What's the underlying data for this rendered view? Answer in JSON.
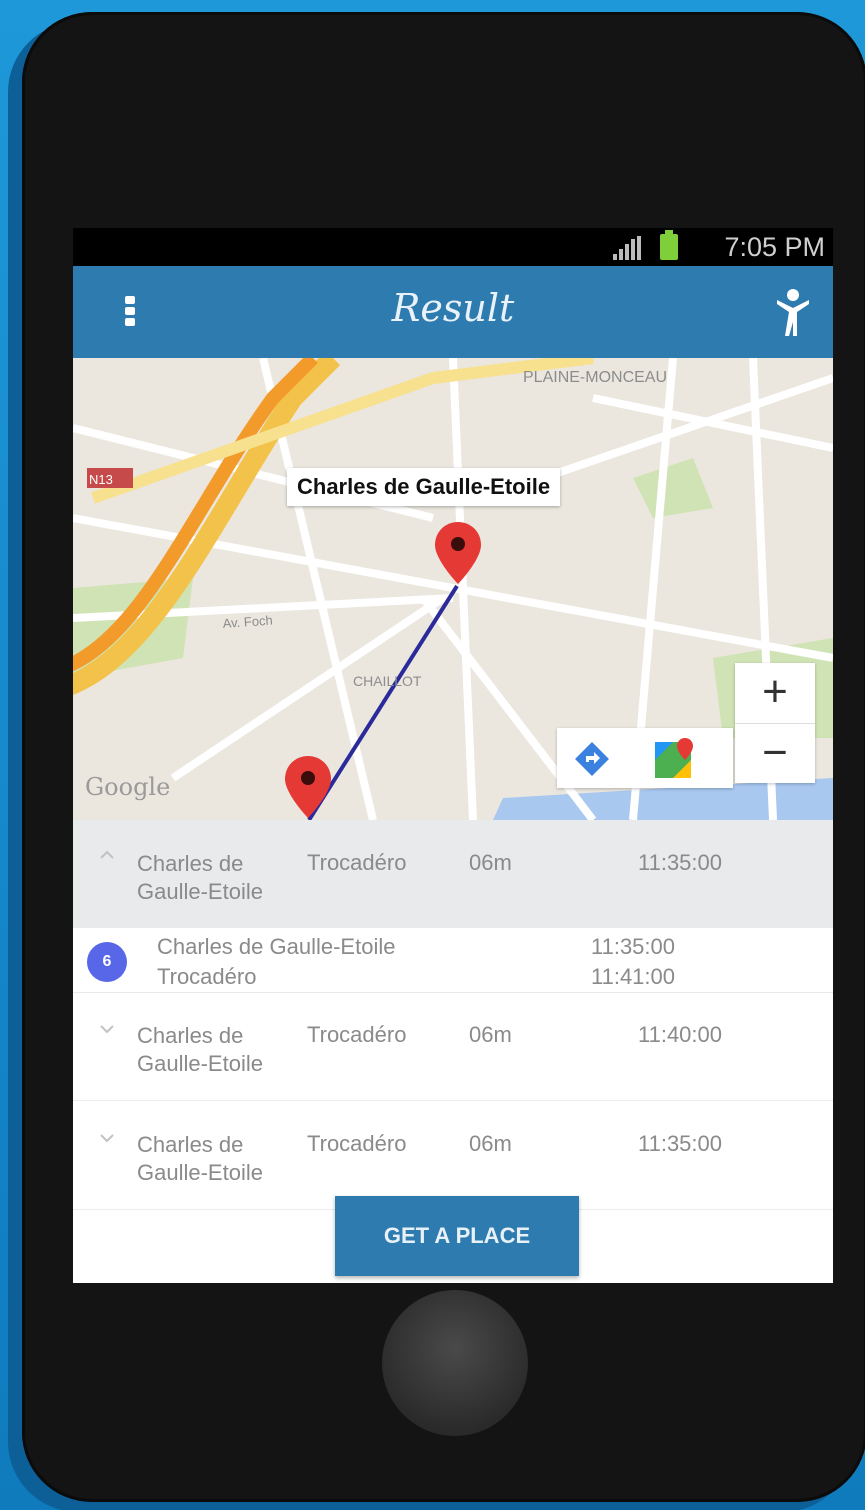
{
  "status_bar": {
    "time": "7:05 PM"
  },
  "app_bar": {
    "title": "Result"
  },
  "map": {
    "station_label": "Charles de Gaulle-Etoile",
    "zoom_in": "+",
    "zoom_out": "−",
    "attribution": "Google",
    "street_labels": [
      "PLAINE-MONCEAU",
      "N13",
      "Av. Foch",
      "CHAILLOT"
    ]
  },
  "list": {
    "rows": [
      {
        "origin": "Charles de Gaulle-Etoile",
        "destination": "Trocadéro",
        "duration": "06m",
        "time": "11:35:00",
        "state": "collapsed"
      },
      {
        "badge": "6",
        "line1": "Charles de Gaulle-Etoile",
        "line2": "Trocadéro",
        "time1": "11:35:00",
        "time2": "11:41:00",
        "state": "expanded"
      },
      {
        "origin": "Charles de Gaulle-Etoile",
        "destination": "Trocadéro",
        "duration": "06m",
        "time": "11:40:00",
        "state": "collapsed"
      },
      {
        "origin": "Charles de Gaulle-Etoile",
        "destination": "Trocadéro",
        "duration": "06m",
        "time": "11:35:00",
        "state": "collapsed"
      }
    ]
  },
  "cta": {
    "label": "GET A PLACE"
  },
  "colors": {
    "primary": "#2e7bb0",
    "background": "#1487c9",
    "badge": "#5866e8",
    "marker": "#e53935",
    "route": "#2a2a9a"
  },
  "icons": [
    "signal-icon",
    "battery-icon",
    "menu-icon",
    "person-icon",
    "map-pin-icon",
    "directions-icon",
    "google-maps-app-icon",
    "chevron-down-icon"
  ]
}
